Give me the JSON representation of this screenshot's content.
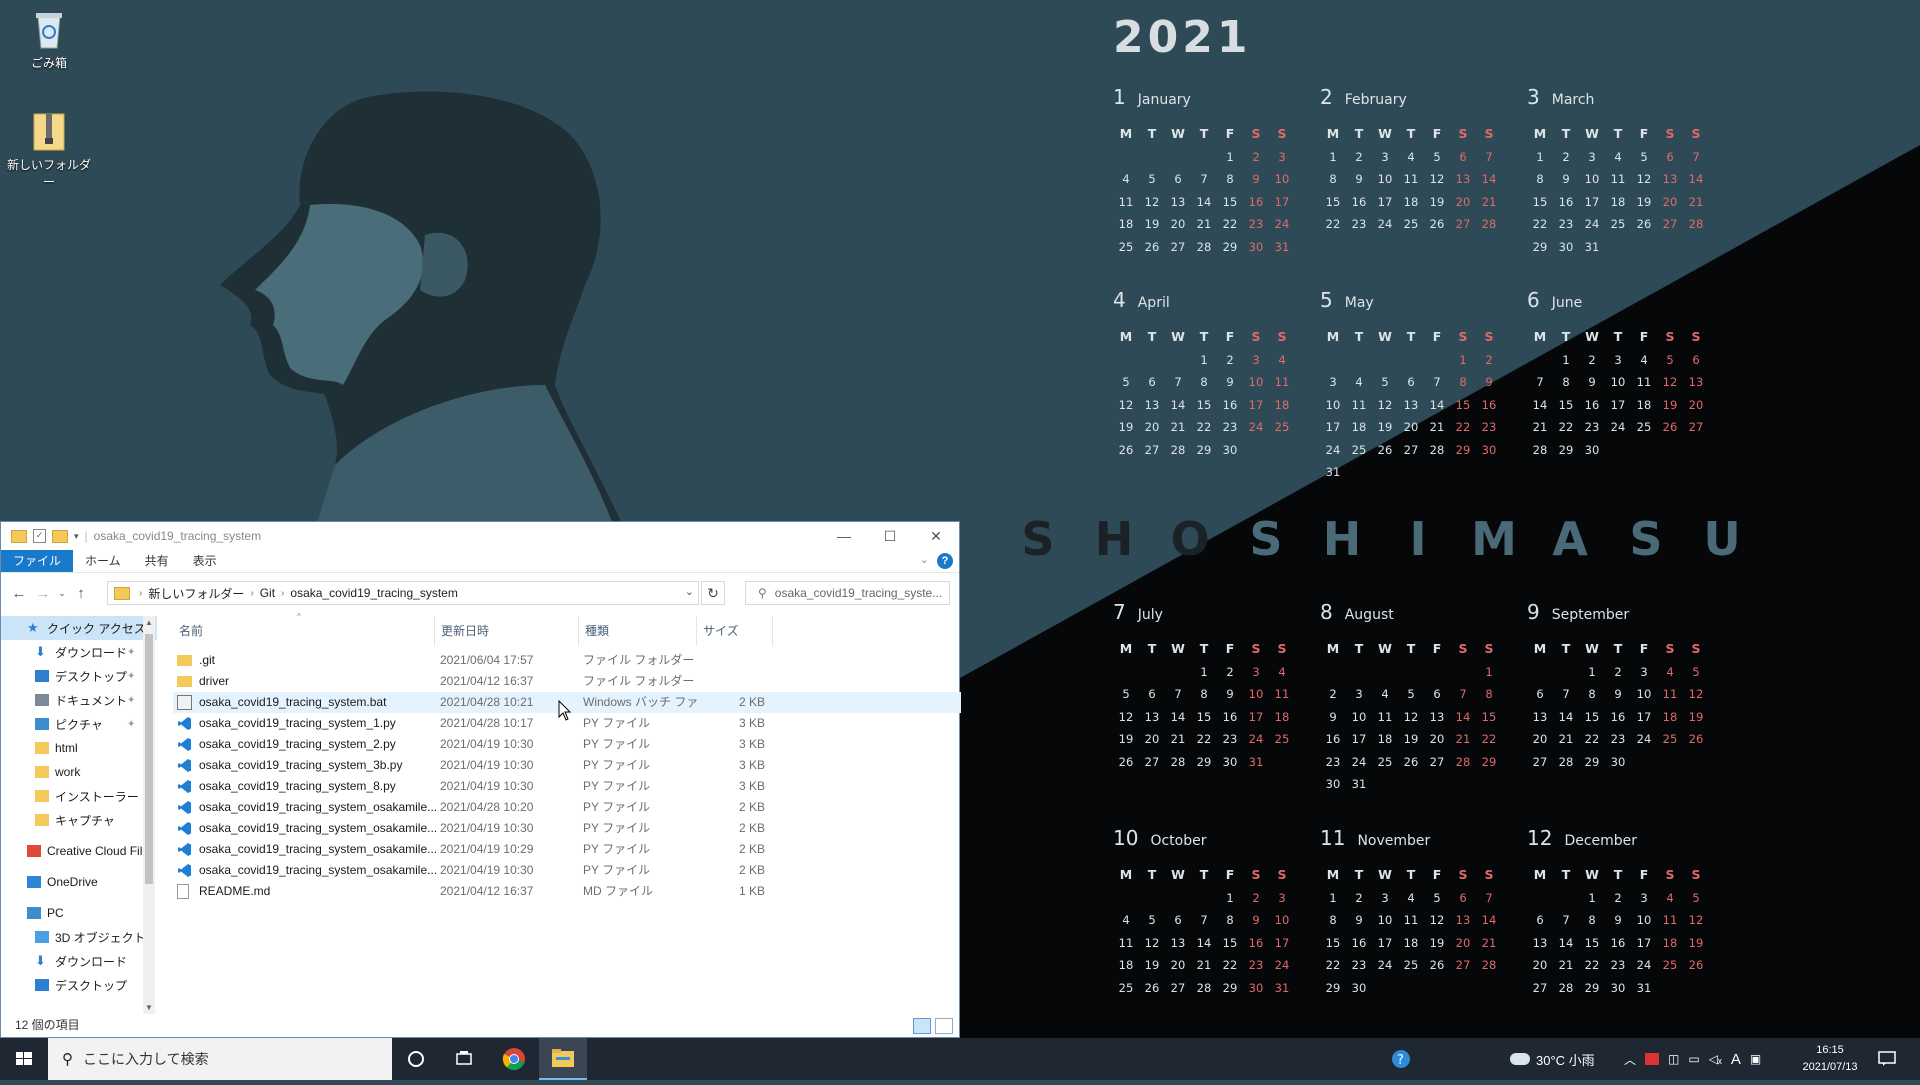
{
  "desktop": {
    "icons": [
      {
        "label": "ごみ箱",
        "icon": "recycle-bin-icon"
      },
      {
        "label": "新しいフォルダー",
        "icon": "zip-folder-icon"
      }
    ]
  },
  "calendar": {
    "year": "2021",
    "banner": "SHOSHIMASU",
    "weekday_headers": [
      "M",
      "T",
      "W",
      "T",
      "F",
      "S",
      "S"
    ],
    "months": [
      {
        "num": "1",
        "name": "January",
        "offset": 4,
        "days": 31
      },
      {
        "num": "2",
        "name": "February",
        "offset": 0,
        "days": 28
      },
      {
        "num": "3",
        "name": "March",
        "offset": 0,
        "days": 31
      },
      {
        "num": "4",
        "name": "April",
        "offset": 3,
        "days": 30
      },
      {
        "num": "5",
        "name": "May",
        "offset": 5,
        "days": 31
      },
      {
        "num": "6",
        "name": "June",
        "offset": 1,
        "days": 30
      },
      {
        "num": "7",
        "name": "July",
        "offset": 3,
        "days": 31
      },
      {
        "num": "8",
        "name": "August",
        "offset": 6,
        "days": 31
      },
      {
        "num": "9",
        "name": "September",
        "offset": 2,
        "days": 30
      },
      {
        "num": "10",
        "name": "October",
        "offset": 4,
        "days": 31
      },
      {
        "num": "11",
        "name": "November",
        "offset": 0,
        "days": 30
      },
      {
        "num": "12",
        "name": "December",
        "offset": 2,
        "days": 31
      }
    ],
    "colors": {
      "weekend": "#e06a6a",
      "light_text": "#dde4e7",
      "dark_letters": "#1a2228",
      "light_letters": "#4a6a78"
    }
  },
  "explorer": {
    "title": "osaka_covid19_tracing_system",
    "ribbon_tabs": [
      "ファイル",
      "ホーム",
      "共有",
      "表示"
    ],
    "help_glyph": "?",
    "breadcrumb": [
      "新しいフォルダー",
      "Git",
      "osaka_covid19_tracing_system"
    ],
    "search_placeholder": "osaka_covid19_tracing_syste...",
    "columns": {
      "name": "名前",
      "date": "更新日時",
      "type": "種類",
      "size": "サイズ"
    },
    "nav_items": [
      {
        "label": "クイック アクセス",
        "icon": "star-icon",
        "indent": 1,
        "selected": true
      },
      {
        "label": "ダウンロード",
        "icon": "download-icon",
        "indent": 2,
        "pinned": true
      },
      {
        "label": "デスクトップ",
        "icon": "desktop-icon",
        "indent": 2,
        "pinned": true
      },
      {
        "label": "ドキュメント",
        "icon": "document-icon",
        "indent": 2,
        "pinned": true
      },
      {
        "label": "ピクチャ",
        "icon": "pictures-icon",
        "indent": 2,
        "pinned": true
      },
      {
        "label": "html",
        "icon": "folder-icon",
        "indent": 2
      },
      {
        "label": "work",
        "icon": "folder-icon",
        "indent": 2
      },
      {
        "label": "インストーラー",
        "icon": "folder-icon",
        "indent": 2
      },
      {
        "label": "キャプチャ",
        "icon": "folder-icon",
        "indent": 2
      },
      {
        "label": "Creative Cloud Files",
        "icon": "creative-cloud-icon",
        "indent": 1
      },
      {
        "label": "OneDrive",
        "icon": "onedrive-icon",
        "indent": 1
      },
      {
        "label": "PC",
        "icon": "pc-icon",
        "indent": 1
      },
      {
        "label": "3D オブジェクト",
        "icon": "3d-objects-icon",
        "indent": 2
      },
      {
        "label": "ダウンロード",
        "icon": "download-icon",
        "indent": 2
      },
      {
        "label": "デスクトップ",
        "icon": "desktop-icon",
        "indent": 2
      }
    ],
    "files": [
      {
        "name": ".git",
        "date": "2021/06/04 17:57",
        "type": "ファイル フォルダー",
        "size": "",
        "icon": "folder-icon"
      },
      {
        "name": "driver",
        "date": "2021/04/12 16:37",
        "type": "ファイル フォルダー",
        "size": "",
        "icon": "folder-icon"
      },
      {
        "name": "osaka_covid19_tracing_system.bat",
        "date": "2021/04/28 10:21",
        "type": "Windows バッチ ファ...",
        "size": "2 KB",
        "icon": "batch-file-icon",
        "hover": true
      },
      {
        "name": "osaka_covid19_tracing_system_1.py",
        "date": "2021/04/28 10:17",
        "type": "PY ファイル",
        "size": "3 KB",
        "icon": "vscode-file-icon"
      },
      {
        "name": "osaka_covid19_tracing_system_2.py",
        "date": "2021/04/19 10:30",
        "type": "PY ファイル",
        "size": "3 KB",
        "icon": "vscode-file-icon"
      },
      {
        "name": "osaka_covid19_tracing_system_3b.py",
        "date": "2021/04/19 10:30",
        "type": "PY ファイル",
        "size": "3 KB",
        "icon": "vscode-file-icon"
      },
      {
        "name": "osaka_covid19_tracing_system_8.py",
        "date": "2021/04/19 10:30",
        "type": "PY ファイル",
        "size": "3 KB",
        "icon": "vscode-file-icon"
      },
      {
        "name": "osaka_covid19_tracing_system_osakamile...",
        "date": "2021/04/28 10:20",
        "type": "PY ファイル",
        "size": "2 KB",
        "icon": "vscode-file-icon"
      },
      {
        "name": "osaka_covid19_tracing_system_osakamile...",
        "date": "2021/04/19 10:30",
        "type": "PY ファイル",
        "size": "2 KB",
        "icon": "vscode-file-icon"
      },
      {
        "name": "osaka_covid19_tracing_system_osakamile...",
        "date": "2021/04/19 10:29",
        "type": "PY ファイル",
        "size": "2 KB",
        "icon": "vscode-file-icon"
      },
      {
        "name": "osaka_covid19_tracing_system_osakamile...",
        "date": "2021/04/19 10:30",
        "type": "PY ファイル",
        "size": "2 KB",
        "icon": "vscode-file-icon"
      },
      {
        "name": "README.md",
        "date": "2021/04/12 16:37",
        "type": "MD ファイル",
        "size": "1 KB",
        "icon": "text-file-icon"
      }
    ],
    "status": "12 個の項目"
  },
  "taskbar": {
    "search_placeholder": "ここに入力して検索",
    "apps": [
      "cortana-icon",
      "task-view-icon",
      "chrome-icon",
      "file-explorer-icon"
    ],
    "weather": "30°C  小雨",
    "ime": "A",
    "time": "16:15",
    "date": "2021/07/13"
  }
}
